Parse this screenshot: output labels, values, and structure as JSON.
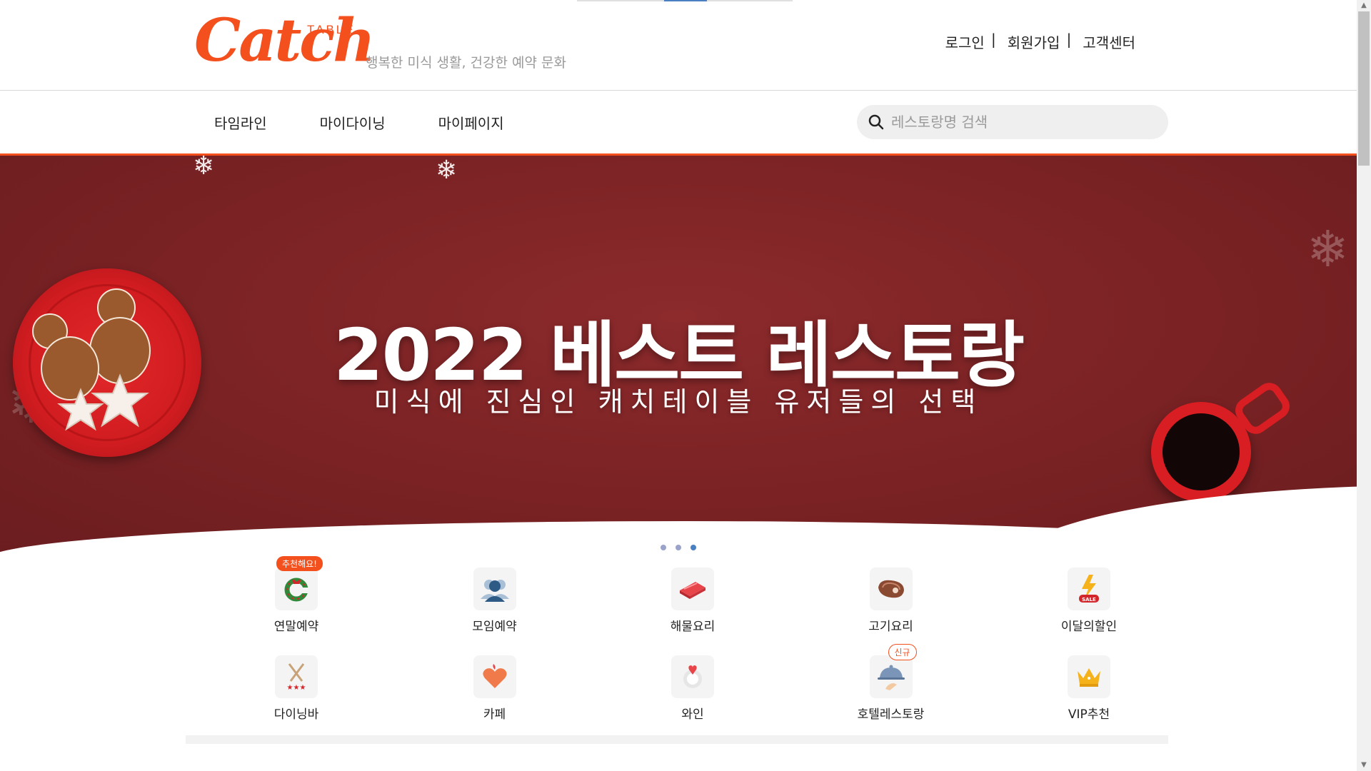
{
  "brand": {
    "logo_text": "Catch",
    "logo_sub": "TABLE",
    "tagline": "행복한 미식 생활, 건강한 예약 문화",
    "accent": "#f3501e"
  },
  "top_links": [
    "로그인",
    "회원가입",
    "고객센터"
  ],
  "nav": {
    "items": [
      "타임라인",
      "마이다이닝",
      "마이페이지"
    ],
    "search_placeholder": "레스토랑명 검색"
  },
  "banner": {
    "title": "2022 베스트 레스토랑",
    "subtitle": "미식에 진심인 캐치테이블 유저들의 선택",
    "background": "#7a2224",
    "slide_count": 3,
    "active_slide": 3
  },
  "categories": [
    [
      {
        "label": "연말예약",
        "icon": "wreath-icon",
        "badge": "추천해요!"
      },
      {
        "label": "모임예약",
        "icon": "people-icon"
      },
      {
        "label": "해물요리",
        "icon": "seafood-icon"
      },
      {
        "label": "고기요리",
        "icon": "steak-icon"
      },
      {
        "label": "이달의할인",
        "icon": "sale-icon"
      }
    ],
    [
      {
        "label": "다이닝바",
        "icon": "dining-bar-icon"
      },
      {
        "label": "카페",
        "icon": "heart-cafe-icon"
      },
      {
        "label": "와인",
        "icon": "wine-icon"
      },
      {
        "label": "호텔레스토랑",
        "icon": "cloche-icon",
        "badge": "신규"
      },
      {
        "label": "VIP추천",
        "icon": "crown-icon"
      }
    ]
  ]
}
